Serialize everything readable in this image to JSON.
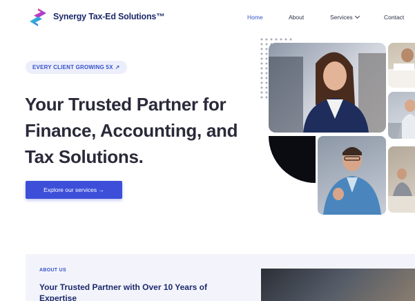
{
  "brand": {
    "name": "Synergy Tax-Ed Solutions™"
  },
  "nav": {
    "home": "Home",
    "about": "About",
    "services": "Services",
    "contact": "Contact"
  },
  "hero": {
    "badge": "EVERY CLIENT GROWING 5X",
    "title_lines": [
      "Your Trusted Partner for",
      "Finance, Accounting, and",
      "Tax Solutions."
    ],
    "cta": "Explore our services →"
  },
  "about": {
    "label": "ABOUT US",
    "title_lines": [
      "Your Trusted Partner with Over 10 Years of",
      "Expertise"
    ]
  },
  "colors": {
    "accent": "#3d4fd8",
    "brand_text": "#1d2a6b",
    "badge_bg": "#eceefb",
    "section_bg": "#f3f4fb"
  },
  "icons": {
    "logo": "brand-s-logo-icon",
    "services_caret": "chevron-down-icon",
    "badge": "trend-up-icon"
  }
}
